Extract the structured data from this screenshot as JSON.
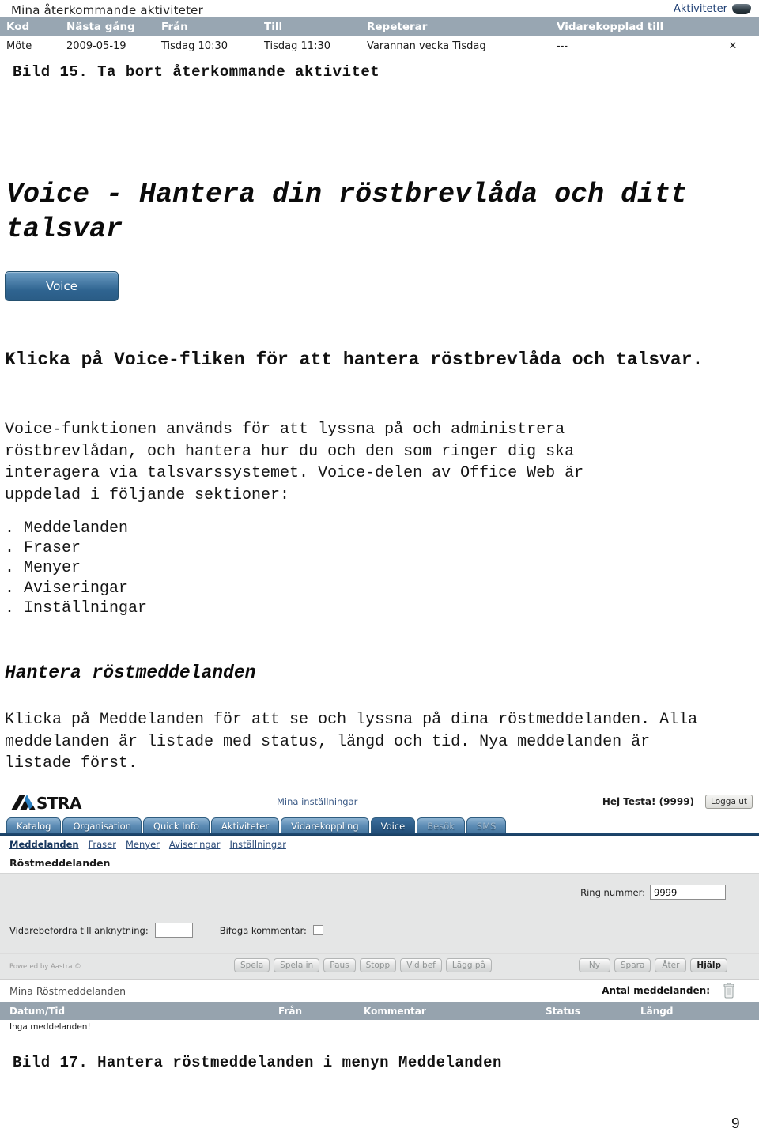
{
  "top_screenshot": {
    "title": "Mina återkommande aktiviteter",
    "right_link": "Aktiviteter",
    "columns": [
      "Kod",
      "Nästa gång",
      "Från",
      "Till",
      "Repeterar",
      "Vidarekopplad till",
      ""
    ],
    "rows": [
      {
        "kod": "Möte",
        "nasta_gang": "2009-05-19",
        "fran": "Tisdag 10:30",
        "till": "Tisdag 11:30",
        "repeterar": "Varannan vecka Tisdag",
        "vidarekopplad": "---",
        "delete": "✕"
      }
    ]
  },
  "captions": {
    "bild15": "Bild 15. Ta bort återkommande aktivitet",
    "bild17": "Bild 17. Hantera röstmeddelanden i menyn Meddelanden"
  },
  "document": {
    "heading": "Voice - Hantera din röstbrevlåda och ditt talsvar",
    "voice_button": "Voice",
    "lead": "Klicka på Voice-fliken för att hantera röstbrevlåda och talsvar.",
    "paragraph": "Voice-funktionen används för att lyssna på och administrera röstbrevlådan, och hantera hur du och den som ringer dig ska interagera via talsvarssystemet. Voice-delen av Office Web är uppdelad i följande sektioner:",
    "bullets": [
      ". Meddelanden",
      ". Fraser",
      ". Menyer",
      ". Aviseringar",
      ". Inställningar"
    ],
    "subheading": "Hantera röstmeddelanden",
    "paragraph2": "Klicka på Meddelanden för att se och lyssna på dina röstmeddelanden. Alla meddelanden är listade med status, längd och tid. Nya meddelanden är listade först.",
    "page_number": "9"
  },
  "office_web": {
    "logo_text": "AASTRA",
    "settings_link": "Mina inställningar",
    "greeting": "Hej Testa! (9999)",
    "logout_button": "Logga ut",
    "tabs": [
      {
        "label": "Katalog",
        "state": "normal"
      },
      {
        "label": "Organisation",
        "state": "normal"
      },
      {
        "label": "Quick Info",
        "state": "normal"
      },
      {
        "label": "Aktiviteter",
        "state": "normal"
      },
      {
        "label": "Vidarekoppling",
        "state": "normal"
      },
      {
        "label": "Voice",
        "state": "active"
      },
      {
        "label": "Besök",
        "state": "disabled"
      },
      {
        "label": "SMS",
        "state": "disabled"
      }
    ],
    "subnav": [
      {
        "label": "Meddelanden",
        "current": true
      },
      {
        "label": "Fraser",
        "current": false
      },
      {
        "label": "Menyer",
        "current": false
      },
      {
        "label": "Aviseringar",
        "current": false
      },
      {
        "label": "Inställningar",
        "current": false
      }
    ],
    "section_title": "Röstmeddelanden",
    "form": {
      "ring_nummer_label": "Ring nummer:",
      "ring_nummer_value": "9999",
      "vidarebefordra_label": "Vidarebefordra till anknytning:",
      "vidarebefordra_value": "",
      "bifoga_label": "Bifoga kommentar:"
    },
    "powered_by": "Powered by Aastra ©",
    "media_buttons": [
      {
        "label": "Spela",
        "enabled": false
      },
      {
        "label": "Spela in",
        "enabled": false
      },
      {
        "label": "Paus",
        "enabled": false
      },
      {
        "label": "Stopp",
        "enabled": false
      },
      {
        "label": "Vid bef",
        "enabled": false
      },
      {
        "label": "Lägg på",
        "enabled": false
      }
    ],
    "action_buttons": [
      {
        "label": "Ny",
        "enabled": false
      },
      {
        "label": "Spara",
        "enabled": false
      },
      {
        "label": "Åter",
        "enabled": false
      },
      {
        "label": "Hjälp",
        "enabled": true
      }
    ],
    "messages": {
      "title": "Mina Röstmeddelanden",
      "count_label": "Antal meddelanden:",
      "columns": [
        "Datum/Tid",
        "Från",
        "Kommentar",
        "Status",
        "Längd"
      ],
      "empty_text": "Inga meddelanden!"
    }
  }
}
